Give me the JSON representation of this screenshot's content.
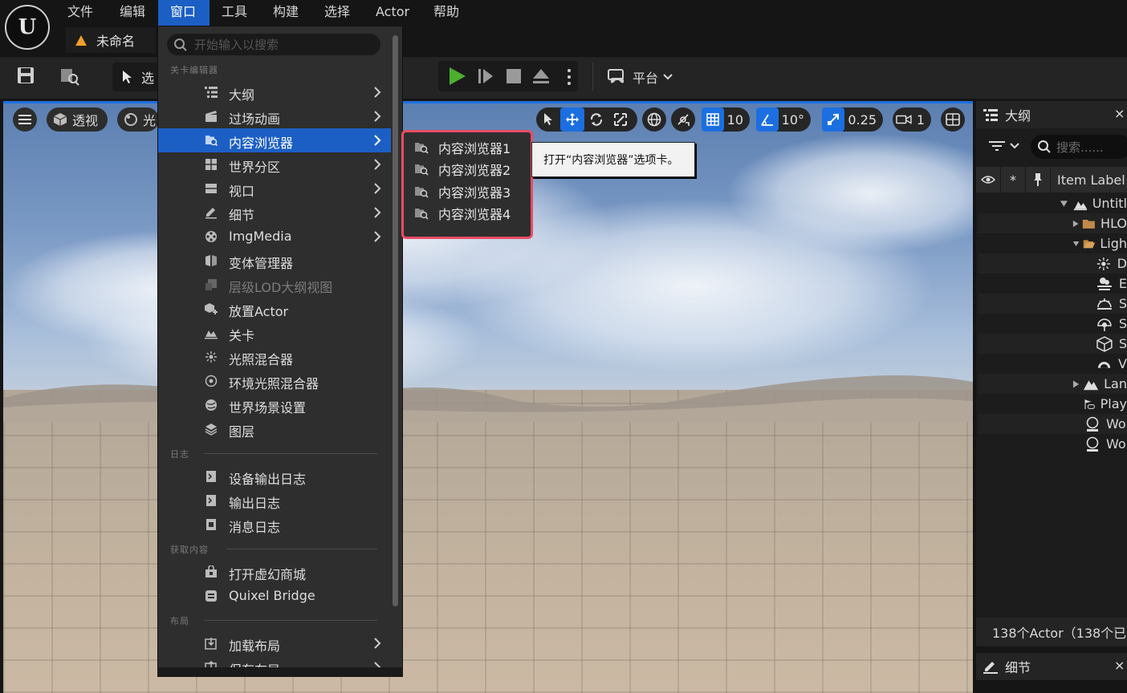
{
  "menubar": {
    "logo": "U",
    "items": [
      {
        "label": "文件"
      },
      {
        "label": "编辑"
      },
      {
        "label": "窗口"
      },
      {
        "label": "工具"
      },
      {
        "label": "构建"
      },
      {
        "label": "选择"
      },
      {
        "label": "Actor"
      },
      {
        "label": "帮助"
      }
    ],
    "active_item": "窗口"
  },
  "level_tab": {
    "label": "未命名"
  },
  "toolbar": {
    "select_mode_label": "选",
    "platform_label": "平台"
  },
  "viewport": {
    "perspective_label": "透视",
    "lit_label": "光",
    "grid_snap_value": "10",
    "rotate_snap_value": "10°",
    "scale_snap_value": "0.25",
    "camera_speed_value": "1"
  },
  "dropdown": {
    "search_placeholder": "开始输入以搜索",
    "sections": {
      "level_editor": "关卡编辑器",
      "log": "日志",
      "get_content": "获取内容",
      "layout": "布局"
    },
    "items": [
      {
        "label": "大纲",
        "icon": "outliner-icon",
        "submenu": true
      },
      {
        "label": "过场动画",
        "icon": "cinematics-icon",
        "submenu": true
      },
      {
        "label": "内容浏览器",
        "icon": "content-browser-icon",
        "submenu": true,
        "highlighted": true
      },
      {
        "label": "世界分区",
        "icon": "world-partition-icon",
        "submenu": true
      },
      {
        "label": "视口",
        "icon": "viewport-icon",
        "submenu": true
      },
      {
        "label": "细节",
        "icon": "details-icon",
        "submenu": true
      },
      {
        "label": "ImgMedia",
        "icon": "imgmedia-icon",
        "submenu": true
      },
      {
        "label": "变体管理器",
        "icon": "variant-manager-icon",
        "submenu": false
      },
      {
        "label": "层级LOD大纲视图",
        "icon": "hlod-icon",
        "submenu": false,
        "disabled": true
      },
      {
        "label": "放置Actor",
        "icon": "place-actor-icon",
        "submenu": false
      },
      {
        "label": "关卡",
        "icon": "levels-icon",
        "submenu": false
      },
      {
        "label": "光照混合器",
        "icon": "light-mixer-icon",
        "submenu": false
      },
      {
        "label": "环境光照混合器",
        "icon": "env-light-mixer-icon",
        "submenu": false
      },
      {
        "label": "世界场景设置",
        "icon": "world-settings-icon",
        "submenu": false
      },
      {
        "label": "图层",
        "icon": "layers-icon",
        "submenu": false
      }
    ],
    "log_items": [
      {
        "label": "设备输出日志",
        "icon": "device-log-icon"
      },
      {
        "label": "输出日志",
        "icon": "output-log-icon"
      },
      {
        "label": "消息日志",
        "icon": "message-log-icon"
      }
    ],
    "content_items": [
      {
        "label": "打开虚幻商城",
        "icon": "marketplace-icon"
      },
      {
        "label": "Quixel Bridge",
        "icon": "bridge-icon"
      }
    ],
    "layout_items": [
      {
        "label": "加载布局",
        "icon": "load-layout-icon",
        "submenu": true
      },
      {
        "label": "保存布局",
        "icon": "save-layout-icon",
        "submenu": true
      }
    ]
  },
  "submenu": {
    "items": [
      {
        "label": "内容浏览器1"
      },
      {
        "label": "内容浏览器2"
      },
      {
        "label": "内容浏览器3"
      },
      {
        "label": "内容浏览器4"
      }
    ],
    "tooltip": "打开“内容浏览器”选项卡。",
    "highlight_color": "#e84d63"
  },
  "outliner": {
    "title": "大纲",
    "close": "×",
    "search_placeholder": "搜索......",
    "column_label": "Item Label",
    "rows": [
      {
        "label": "Untitl"
      },
      {
        "label": "HLO"
      },
      {
        "label": "Ligh"
      },
      {
        "label": "D"
      },
      {
        "label": "E"
      },
      {
        "label": "S"
      },
      {
        "label": "S"
      },
      {
        "label": "S"
      },
      {
        "label": "V"
      },
      {
        "label": "Lan"
      },
      {
        "label": "Play"
      },
      {
        "label": "Wo"
      },
      {
        "label": "Wo"
      }
    ],
    "footer": "138个Actor（138个已"
  },
  "details": {
    "title": "细节",
    "close": "×"
  },
  "colors": {
    "accent": "#1c5fc4",
    "viewport_accent": "#1c6fe0",
    "play_green": "#4caf2f"
  }
}
